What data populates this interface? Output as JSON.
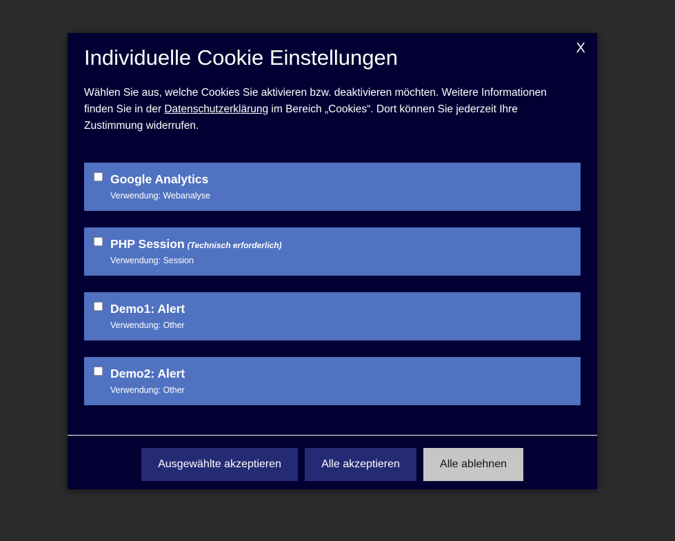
{
  "modal": {
    "close_label": "X",
    "title": "Individuelle Cookie Einstellungen",
    "intro_part1": "Wählen Sie aus, welche Cookies Sie aktivieren bzw. deaktivieren möchten. Weitere Informationen finden Sie in der ",
    "intro_link": "Datenschutzerklärung",
    "intro_part2": " im Bereich „Cookies“. Dort können Sie jederzeit Ihre Zustimmung widerrufen."
  },
  "cookies": [
    {
      "name": "Google Analytics",
      "tag": "",
      "usage": "Verwendung: Webanalyse",
      "checked": false
    },
    {
      "name": "PHP Session",
      "tag": "(Technisch erforderlich)",
      "usage": "Verwendung: Session",
      "checked": false
    },
    {
      "name": "Demo1: Alert",
      "tag": "",
      "usage": "Verwendung: Other",
      "checked": false
    },
    {
      "name": "Demo2: Alert",
      "tag": "",
      "usage": "Verwendung: Other",
      "checked": false
    }
  ],
  "footer": {
    "accept_selected": "Ausgewählte akzeptieren",
    "accept_all": "Alle akzeptieren",
    "reject_all": "Alle ablehnen"
  },
  "colors": {
    "overlay": "#2b2b2b",
    "modal_bg": "#020032",
    "item_bg": "#5072c0",
    "primary_button": "#252a74",
    "secondary_button": "#c6c6c6"
  }
}
